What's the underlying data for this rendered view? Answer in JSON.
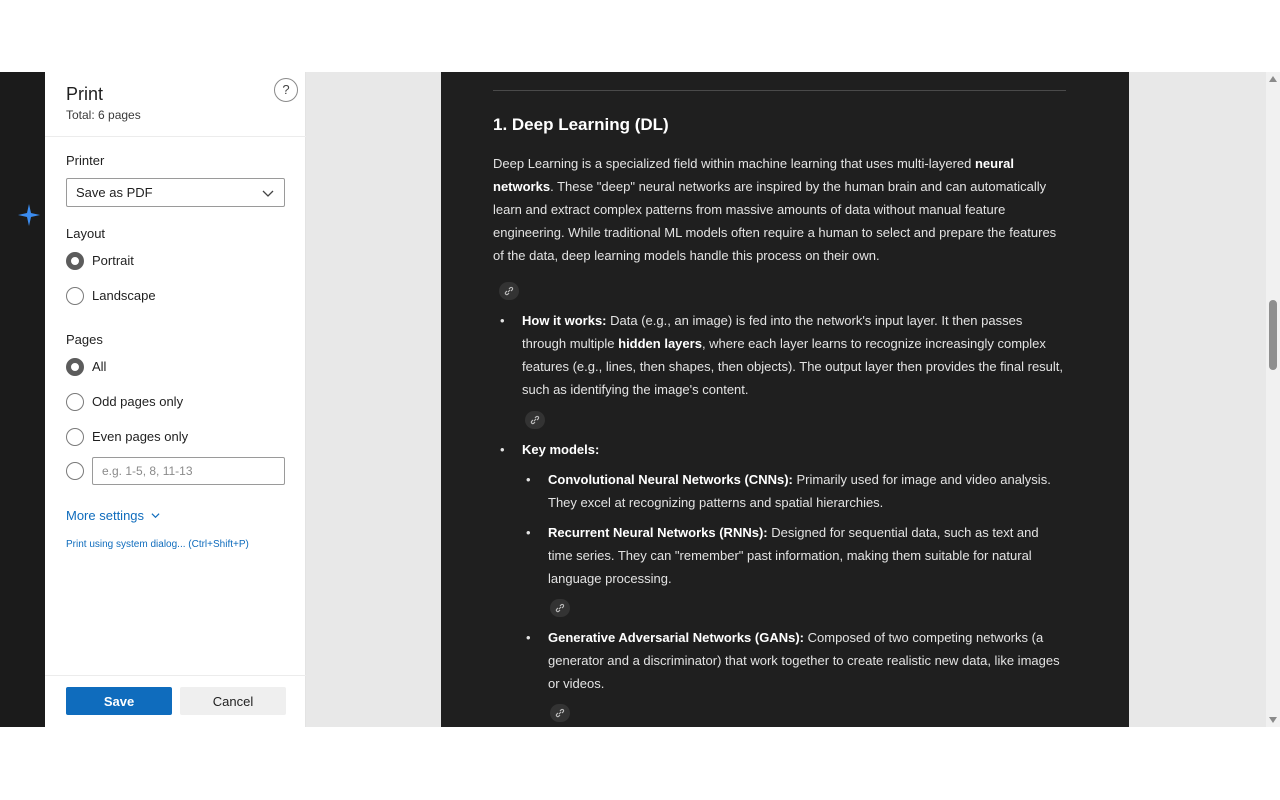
{
  "print_panel": {
    "title": "Print",
    "total": "Total: 6 pages",
    "help": "?",
    "printer_label": "Printer",
    "printer_value": "Save as PDF",
    "layout_label": "Layout",
    "layout_options": [
      "Portrait",
      "Landscape"
    ],
    "layout_selected": "Portrait",
    "pages_label": "Pages",
    "pages_options": [
      "All",
      "Odd pages only",
      "Even pages only"
    ],
    "pages_selected": "All",
    "range_placeholder": "e.g. 1-5, 8, 11-13",
    "more_settings": "More settings",
    "system_dialog": "Print using system dialog... (Ctrl+Shift+P)",
    "save_label": "Save",
    "cancel_label": "Cancel"
  },
  "preview": {
    "heading": "1. Deep Learning (DL)",
    "intro": {
      "t1": "Deep Learning is a specialized field within machine learning that uses multi-layered ",
      "b1": "neural networks",
      "t2": ". These \"deep\" neural networks are inspired by the human brain and can automatically learn and extract complex patterns from massive amounts of data without manual feature engineering. While traditional ML models often require a human to select and prepare the features of the data, deep learning models handle this process on their own."
    },
    "how_it_works": {
      "label": "How it works:",
      "t1": " Data (e.g., an image) is fed into the network's input layer. It then passes through multiple ",
      "b1": "hidden layers",
      "t2": ", where each layer learns to recognize increasingly complex features (e.g., lines, then shapes, then objects). The output layer then provides the final result, such as identifying the image's content."
    },
    "key_models_label": "Key models:",
    "models": [
      {
        "name": "Convolutional Neural Networks (CNNs):",
        "desc": " Primarily used for image and video analysis. They excel at recognizing patterns and spatial hierarchies."
      },
      {
        "name": "Recurrent Neural Networks (RNNs):",
        "desc": " Designed for sequential data, such as text and time series. They can \"remember\" past information, making them suitable for natural language processing."
      },
      {
        "name": "Generative Adversarial Networks (GANs):",
        "desc": " Composed of two competing networks (a generator and a discriminator) that work together to create realistic new data, like images or videos."
      }
    ]
  },
  "colors": {
    "accent": "#0f6cbd",
    "page_background": "#1f1f1f",
    "preview_background": "#e8e8e8"
  }
}
